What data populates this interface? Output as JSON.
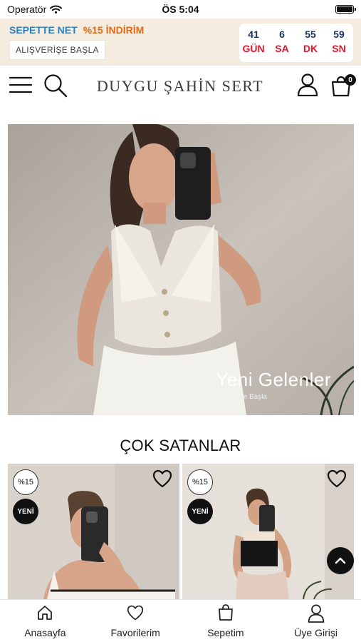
{
  "status_bar": {
    "carrier": "Operatör",
    "time": "ÖS 5:04"
  },
  "promo": {
    "net_label": "SEPETTE NET",
    "discount_label": "%15 İNDİRİM",
    "shop_button": "ALIŞVERİŞE BAŞLA",
    "countdown": [
      {
        "value": "41",
        "unit": "GÜN"
      },
      {
        "value": "6",
        "unit": "SA"
      },
      {
        "value": "55",
        "unit": "DK"
      },
      {
        "value": "59",
        "unit": "SN"
      }
    ],
    "colors": {
      "net": "#2f7fc1",
      "discount": "#e06a17",
      "count_number": "#1d3463",
      "count_unit": "#e3152b",
      "background": "#f4ecdf"
    }
  },
  "header": {
    "brand": "DUYGU ŞAHİN SERT",
    "cart_count": "0",
    "icons": [
      "menu-icon",
      "search-icon",
      "user-icon",
      "shopping-bag-icon"
    ]
  },
  "hero": {
    "caption": "Yeni Gelenler",
    "subcaption": "»Alışverişe Başla"
  },
  "bestsellers": {
    "title": "ÇOK SATANLAR",
    "products": [
      {
        "discount_badge": "%15",
        "new_badge": "YENİ"
      },
      {
        "discount_badge": "%15",
        "new_badge": "YENİ"
      }
    ]
  },
  "tabbar": {
    "tabs": [
      {
        "label": "Anasayfa",
        "icon": "home-icon"
      },
      {
        "label": "Favorilerim",
        "icon": "heart-icon"
      },
      {
        "label": "Sepetim",
        "icon": "bag-icon"
      },
      {
        "label": "Üye Girişi",
        "icon": "user-icon"
      }
    ]
  }
}
